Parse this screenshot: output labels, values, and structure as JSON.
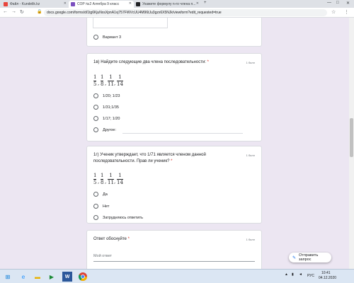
{
  "browser": {
    "tabs": [
      {
        "label": "Файл - Kundelik.kz",
        "color": "#e8453c"
      },
      {
        "label": "СОР №2 Алгебра 9 класс",
        "color": "#7b4fbf"
      },
      {
        "label": "Укажите формулу n-го члена п...",
        "color": "#202124"
      }
    ],
    "url": "docs.google.com/forms/d/1tg6KjuNxsXpnA1vj757FWVcUU4M96tJu3gzx6X5NJk/viewform?edit_requested=true",
    "controls": {
      "minimize": "—",
      "maximize": "□",
      "close": "✕"
    }
  },
  "form": {
    "prev_option": "Вариант 3",
    "q1": {
      "title": "1в) Найдите следующие два члена последовательности:",
      "required_mark": "*",
      "points": "1 балл",
      "sequence": [
        "1/5",
        "1/8",
        "1/11",
        "1/14"
      ],
      "options": [
        "1/20; 1/23",
        "1/31;1/35",
        "1/17; 1/20",
        "Другое:"
      ]
    },
    "q2": {
      "title_line1": "1г) Ученик утверждает, что 1/71 является членом данной",
      "title_line2": "последовательности. Прав ли ученик?",
      "required_mark": "*",
      "points": "1 балл",
      "sequence": [
        "1/5",
        "1/8",
        "1/11",
        "1/14"
      ],
      "options": [
        "Да",
        "Нет",
        "Затрудняюсь ответить"
      ]
    },
    "q3": {
      "title": "Ответ обоснуйте",
      "required_mark": "*",
      "points": "1 балл",
      "placeholder": "Мой ответ"
    },
    "send_button": "Отправить запрос"
  },
  "taskbar": {
    "language": "РУС",
    "time": "10:41",
    "date": "04.12.2020"
  }
}
